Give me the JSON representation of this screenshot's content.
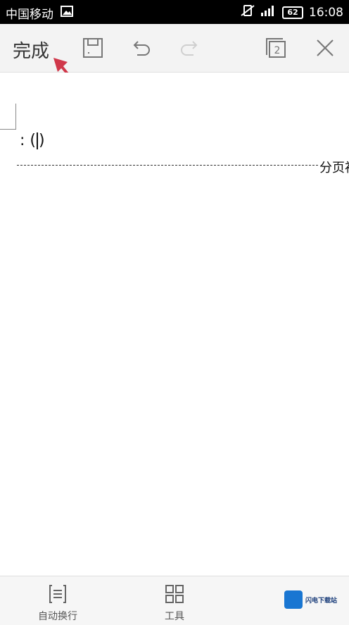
{
  "status_bar": {
    "carrier": "中国移动",
    "battery": "62",
    "time": "16:08"
  },
  "toolbar": {
    "done_label": "完成",
    "page_count": "2"
  },
  "document": {
    "text": ": (",
    "text_after_cursor": ")",
    "page_break_label": "分页衫"
  },
  "bottom_bar": {
    "wrap_label": "自动换行",
    "tools_label": "工具"
  },
  "watermark": {
    "text": "闪电下载站"
  },
  "colors": {
    "status_bar_bg": "#000000",
    "toolbar_bg": "#f3f3f3",
    "annotation_arrow": "#d0384a"
  },
  "icons": {
    "save": "save-icon",
    "undo": "undo-icon",
    "redo": "redo-icon",
    "pages": "pages-icon",
    "close": "close-icon",
    "wrap": "wrap-lines-icon",
    "tools": "grid-tools-icon"
  }
}
